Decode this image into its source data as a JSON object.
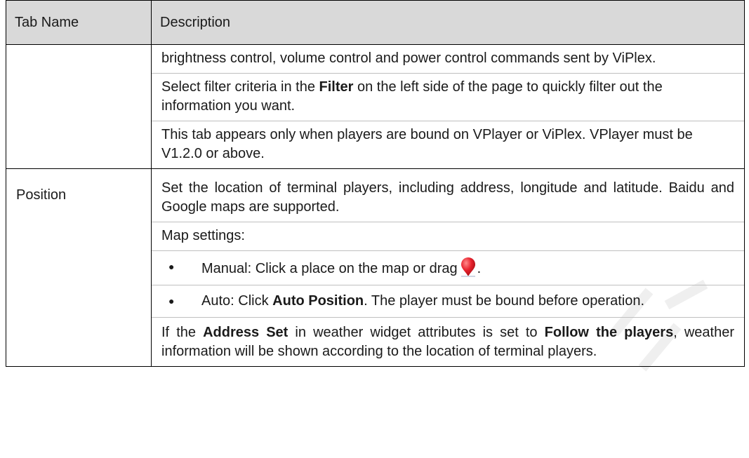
{
  "table": {
    "headers": [
      "Tab Name",
      "Description"
    ],
    "rows": [
      {
        "name": "",
        "para1": "brightness control, volume control and power control commands sent by ViPlex.",
        "para2": {
          "pre": "Select filter criteria in the ",
          "bold": "Filter",
          "post": " on the left side of the page to quickly filter out the information you want."
        },
        "para3": "This tab appears only when players are bound on VPlayer or ViPlex. VPlayer must be V1.2.0 or above."
      },
      {
        "name": "Position",
        "para1": "Set the location of terminal players, including address, longitude and latitude. Baidu and Google maps are supported.",
        "para2": "Map settings:",
        "bullet1": {
          "pre": "Manual: Click a place on the map or drag",
          "post": ".",
          "icon": "map-pin-icon"
        },
        "bullet2": {
          "pre": "Auto: Click ",
          "bold": "Auto Position",
          "post": ". The player must be bound before operation."
        },
        "para3": {
          "pre": "If the ",
          "bold1": "Address Set",
          "mid": " in weather widget attributes is set to ",
          "bold2": "Follow the players",
          "post": ", weather information will be shown according to the location of terminal players."
        }
      }
    ]
  },
  "colors": {
    "header_bg": "#d9d9d9",
    "pin": "#e8222d"
  }
}
